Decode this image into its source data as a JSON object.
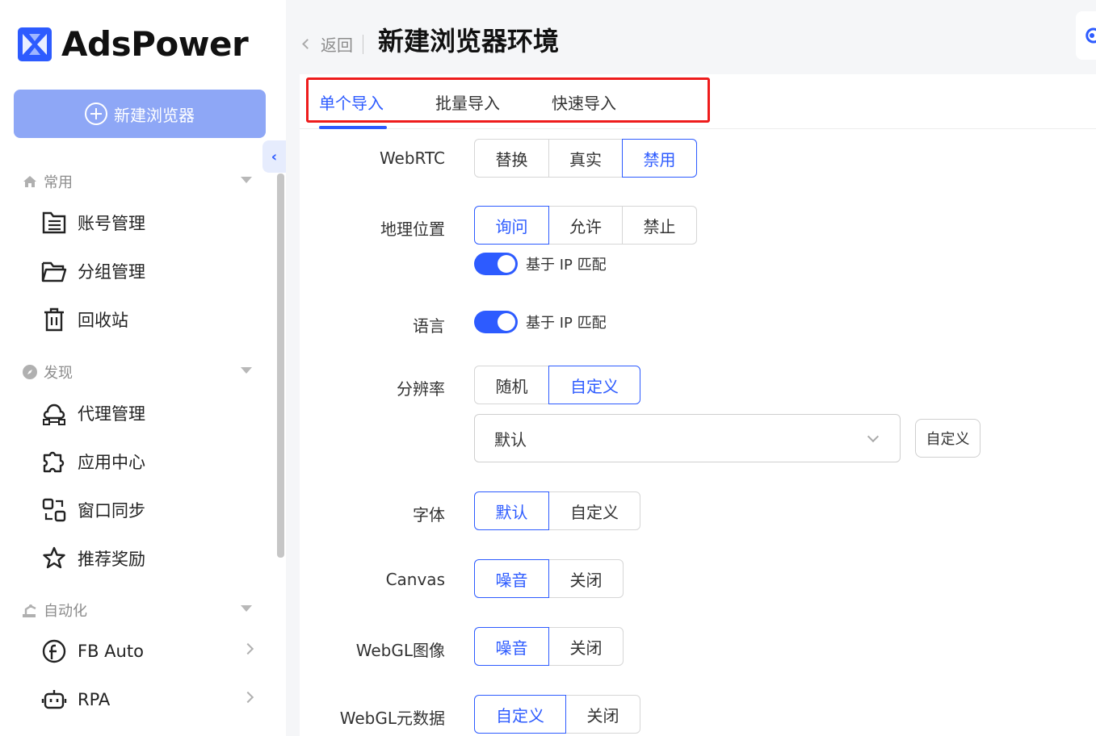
{
  "app": {
    "logo_text": "AdsPower"
  },
  "sidebar": {
    "new_button": "新建浏览器",
    "sections": [
      {
        "label": "常用",
        "icon": "home-icon"
      },
      {
        "label": "发现",
        "icon": "compass-icon"
      },
      {
        "label": "自动化",
        "icon": "robot-arm-icon"
      }
    ],
    "items": [
      {
        "label": "账号管理",
        "icon": "account-list-icon"
      },
      {
        "label": "分组管理",
        "icon": "folder-icon"
      },
      {
        "label": "回收站",
        "icon": "trash-icon"
      },
      {
        "label": "代理管理",
        "icon": "proxy-icon"
      },
      {
        "label": "应用中心",
        "icon": "puzzle-icon"
      },
      {
        "label": "窗口同步",
        "icon": "window-sync-icon"
      },
      {
        "label": "推荐奖励",
        "icon": "star-icon"
      },
      {
        "label": "FB Auto",
        "icon": "facebook-icon"
      },
      {
        "label": "RPA",
        "icon": "robot-icon"
      }
    ]
  },
  "header": {
    "back_label": "返回",
    "title": "新建浏览器环境"
  },
  "tabs": [
    {
      "label": "单个导入",
      "active": true
    },
    {
      "label": "批量导入",
      "active": false
    },
    {
      "label": "快速导入",
      "active": false
    }
  ],
  "form": {
    "webrtc": {
      "label": "WebRTC",
      "options": [
        "替换",
        "真实",
        "禁用"
      ],
      "selected": "禁用"
    },
    "geo": {
      "label": "地理位置",
      "options": [
        "询问",
        "允许",
        "禁止"
      ],
      "selected": "询问",
      "toggle_label": "基于 IP 匹配",
      "toggle_on": true
    },
    "language": {
      "label": "语言",
      "toggle_label": "基于 IP 匹配",
      "toggle_on": true
    },
    "resolution": {
      "label": "分辨率",
      "options": [
        "随机",
        "自定义"
      ],
      "selected": "自定义",
      "select_value": "默认",
      "custom_button": "自定义"
    },
    "font": {
      "label": "字体",
      "options": [
        "默认",
        "自定义"
      ],
      "selected": "默认"
    },
    "canvas": {
      "label": "Canvas",
      "options": [
        "噪音",
        "关闭"
      ],
      "selected": "噪音"
    },
    "webgl_image": {
      "label": "WebGL图像",
      "options": [
        "噪音",
        "关闭"
      ],
      "selected": "噪音"
    },
    "webgl_meta": {
      "label": "WebGL元数据",
      "options": [
        "自定义",
        "关闭"
      ],
      "selected": "自定义"
    }
  },
  "colors": {
    "accent": "#2d5bff",
    "highlight": "#ee1c1c",
    "button_light": "#8ea7f6"
  }
}
